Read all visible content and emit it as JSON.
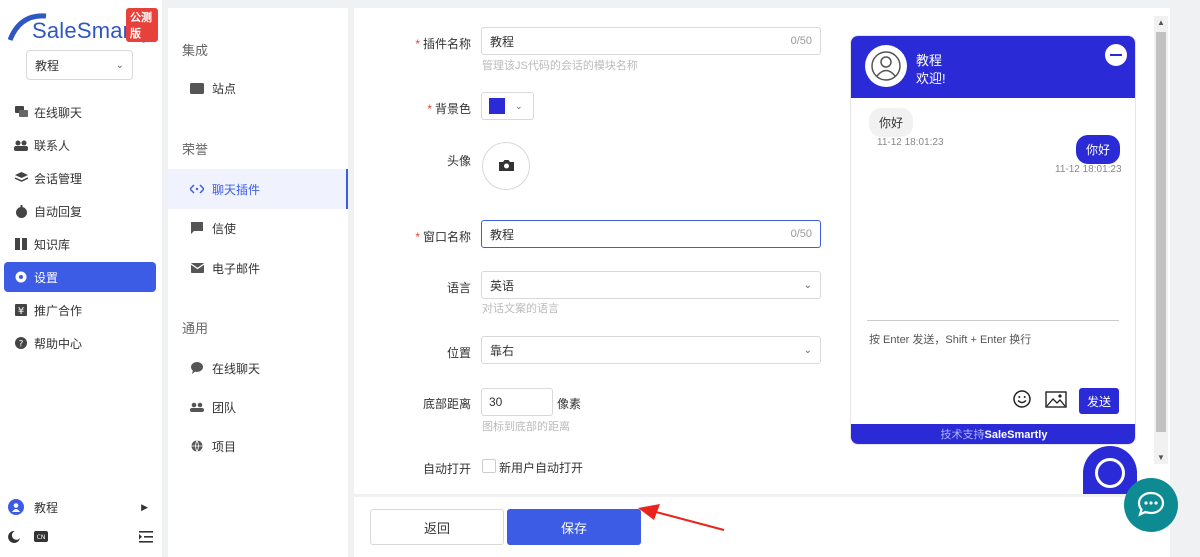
{
  "brand": {
    "logo_text": "SaleSmartly",
    "badge": "公测版"
  },
  "workspace": {
    "selected": "教程"
  },
  "nav": {
    "items": [
      {
        "label": "在线聊天",
        "icon": "chat-icon"
      },
      {
        "label": "联系人",
        "icon": "contacts-icon"
      },
      {
        "label": "会话管理",
        "icon": "layers-icon"
      },
      {
        "label": "自动回复",
        "icon": "robot-icon"
      },
      {
        "label": "知识库",
        "icon": "book-icon"
      },
      {
        "label": "设置",
        "icon": "settings-icon",
        "active": true
      },
      {
        "label": "推广合作",
        "icon": "yen-icon"
      },
      {
        "label": "帮助中心",
        "icon": "help-icon"
      }
    ]
  },
  "user": {
    "name": "教程"
  },
  "submenu": {
    "sections": [
      {
        "title": "集成",
        "items": [
          {
            "label": "站点",
            "icon": "folder-icon"
          }
        ]
      },
      {
        "title": "荣誉",
        "items": [
          {
            "label": "聊天插件",
            "icon": "code-icon",
            "active": true
          },
          {
            "label": "信使",
            "icon": "message-icon"
          },
          {
            "label": "电子邮件",
            "icon": "mail-icon"
          }
        ]
      },
      {
        "title": "通用",
        "items": [
          {
            "label": "在线聊天",
            "icon": "chat-bubble-icon"
          },
          {
            "label": "团队",
            "icon": "team-icon"
          },
          {
            "label": "项目",
            "icon": "globe-icon"
          }
        ]
      }
    ]
  },
  "form": {
    "plugin_name": {
      "label": "插件名称",
      "value": "教程",
      "count": "0/50",
      "help": "管理该JS代码的会话的模块名称"
    },
    "bg_color": {
      "label": "背景色",
      "value": "#2a2ad6"
    },
    "avatar": {
      "label": "头像"
    },
    "window_name": {
      "label": "窗口名称",
      "value": "教程",
      "count": "0/50"
    },
    "language": {
      "label": "语言",
      "value": "英语",
      "help": "对话文案的语言"
    },
    "position": {
      "label": "位置",
      "value": "靠右"
    },
    "bottom_distance": {
      "label": "底部距离",
      "value": "30",
      "unit": "像素",
      "help": "图标到底部的距离"
    },
    "auto_open": {
      "label": "自动打开",
      "option": "新用户自动打开"
    }
  },
  "preview": {
    "title": "教程",
    "subtitle": "欢迎!",
    "messages": [
      {
        "side": "left",
        "text": "你好",
        "time": "11-12 18:01:23"
      },
      {
        "side": "right",
        "text": "你好",
        "time": "11-12 18:01:23"
      }
    ],
    "input_hint": "按 Enter 发送，Shift + Enter 换行",
    "send_label": "发送",
    "footer_prefix": "技术支持",
    "footer_brand": "SaleSmartly"
  },
  "actions": {
    "back": "返回",
    "save": "保存"
  },
  "colors": {
    "accent": "#3d5ce5",
    "widget": "#2a2ad6",
    "fab": "#0e8a92",
    "required": "#e8413b"
  }
}
